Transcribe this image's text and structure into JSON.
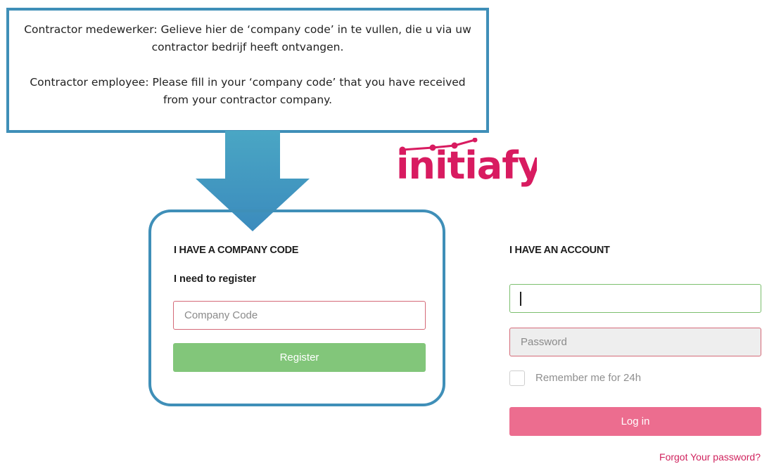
{
  "callout": {
    "dutch_text": "Contractor medewerker: Gelieve hier de ‘company code’ in te vullen, die u via uw contractor bedrijf heeft ontvangen.",
    "english_text": "Contractor employee: Please fill in your ‘company code’ that you have received from your contractor company."
  },
  "logo": {
    "text": "initiafy",
    "color": "#d81b60"
  },
  "register_panel": {
    "title": "I HAVE A COMPANY CODE",
    "subtitle": "I need to register",
    "company_code": {
      "value": "",
      "placeholder": "Company Code"
    },
    "register_label": "Register"
  },
  "login_panel": {
    "title": "I HAVE AN ACCOUNT",
    "username": {
      "value": "",
      "placeholder": ""
    },
    "password": {
      "value": "",
      "placeholder": "Password"
    },
    "remember_label": "Remember me for 24h",
    "remember_checked": false,
    "login_label": "Log in",
    "forgot_label": "Forgot Your password?"
  },
  "colors": {
    "callout_border": "#3f8fb8",
    "register_button": "#82c67a",
    "login_button": "#ec6d8f",
    "error_border": "#d46a78",
    "focus_border": "#7bbf6e",
    "link": "#d0235e"
  }
}
